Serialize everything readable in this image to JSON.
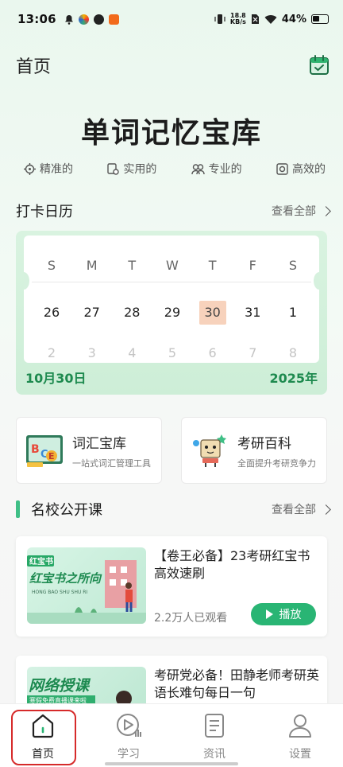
{
  "status_bar": {
    "time": "13:06",
    "net_speed_top": "18.8",
    "net_speed_unit": "KB/s",
    "battery": "44%"
  },
  "header": {
    "title": "首页"
  },
  "hero": {
    "title": "单词记忆宝库",
    "features": [
      "精准的",
      "实用的",
      "专业的",
      "高效的"
    ]
  },
  "checkin": {
    "label": "打卡日历",
    "more": "查看全部",
    "weekdays": [
      "S",
      "M",
      "T",
      "W",
      "T",
      "F",
      "S"
    ],
    "days": [
      "26",
      "27",
      "28",
      "29",
      "30",
      "31",
      "1"
    ],
    "today_index": 4,
    "next_days": [
      "2",
      "3",
      "4",
      "5",
      "6",
      "7",
      "8"
    ],
    "date": "10月30日",
    "year": "2025年"
  },
  "tools": [
    {
      "title": "词汇宝库",
      "subtitle": "一站式词汇管理工具"
    },
    {
      "title": "考研百科",
      "subtitle": "全面提升考研竞争力"
    }
  ],
  "courses_section": {
    "label": "名校公开课",
    "more": "查看全部"
  },
  "courses": [
    {
      "title": "【卷王必备】23考研红宝书高效速刷",
      "views": "2.2万人已观看",
      "play": "播放",
      "thumb_tag": "红宝书",
      "thumb_text": "红宝书之所向",
      "thumb_sub": "HONG BAO SHU SHU RI"
    },
    {
      "title": "考研党必备！田静老师考研英语长难句每日一句",
      "thumb_text": "网络授课",
      "thumb_sub": "寒假免费直播课来啦"
    }
  ],
  "tabbar": {
    "items": [
      "首页",
      "学习",
      "资讯",
      "设置"
    ],
    "active": 0
  },
  "colors": {
    "accent": "#29b574",
    "today_bg": "#f7d2bc",
    "highlight_box": "#d62a2a"
  }
}
